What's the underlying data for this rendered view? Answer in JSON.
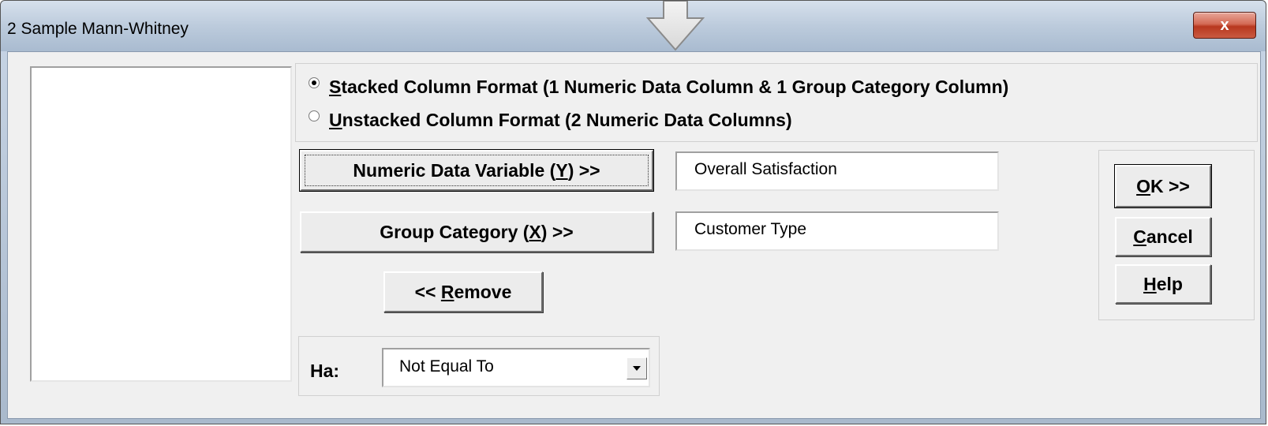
{
  "window": {
    "title": "2 Sample Mann-Whitney",
    "close_label": "x"
  },
  "format": {
    "stacked": {
      "accel": "S",
      "label": "tacked Column Format (1 Numeric Data Column & 1 Group Category Column)",
      "selected": true
    },
    "unstacked": {
      "accel": "U",
      "label": "nstacked Column Format (2 Numeric Data Columns)",
      "selected": false
    }
  },
  "variables": {
    "numeric_button": {
      "pre": "Numeric Data Variable  (",
      "accel": "Y",
      "post": ") >>"
    },
    "numeric_value": "Overall Satisfaction",
    "group_button": {
      "pre": "Group Category (",
      "accel": "X",
      "post": ") >>"
    },
    "group_value": "Customer Type",
    "remove_button": {
      "pre": "<< ",
      "accel": "R",
      "post": "emove"
    }
  },
  "ha": {
    "label": "Ha:",
    "selected": "Not Equal To"
  },
  "actions": {
    "ok": {
      "accel": "O",
      "post": "K >>"
    },
    "cancel": {
      "accel": "C",
      "post": "ancel"
    },
    "help": {
      "accel": "H",
      "post": "elp"
    }
  },
  "colors": {
    "dialog_bg": "#f0f0f0",
    "title_bar": "#bccbdc",
    "close_button": "#c9462c"
  },
  "icons": [
    "down-arrow-icon",
    "close-icon",
    "dropdown-arrow-icon"
  ]
}
